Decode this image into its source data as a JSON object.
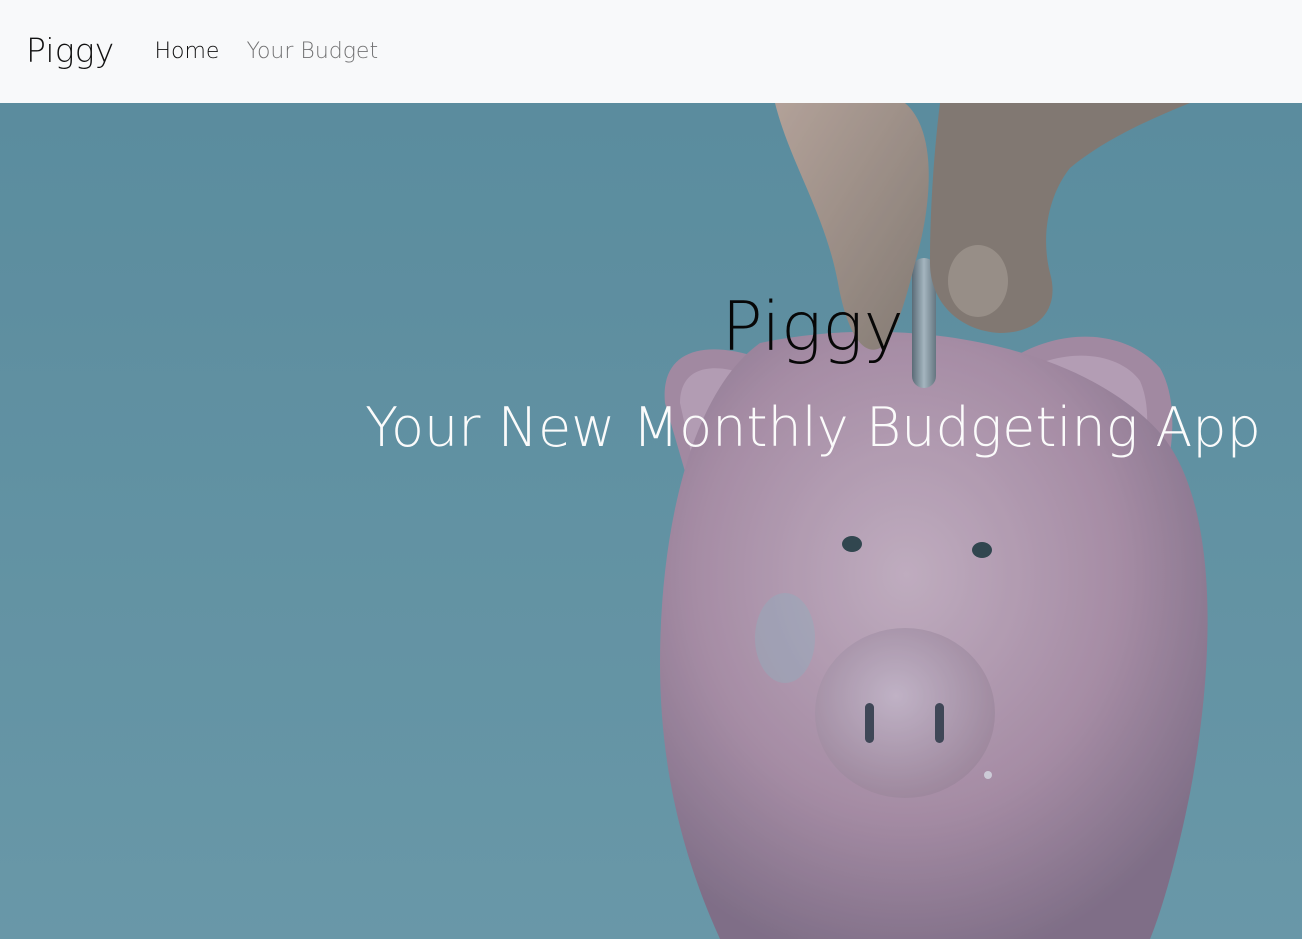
{
  "navbar": {
    "brand": "Piggy",
    "links": [
      {
        "label": "Home",
        "active": true
      },
      {
        "label": "Your Budget",
        "active": false
      }
    ]
  },
  "hero": {
    "title": "Piggy",
    "subtitle": "Your New Monthly Budgeting App",
    "image": "piggy-bank-coin-photo"
  },
  "colors": {
    "navbar_bg": "#f8f9fa",
    "hero_overlay": "#5f8fa0",
    "piggy_pink": "#c9a0b8",
    "title_text": "#070707",
    "subtitle_text": "#fbfbfb"
  }
}
